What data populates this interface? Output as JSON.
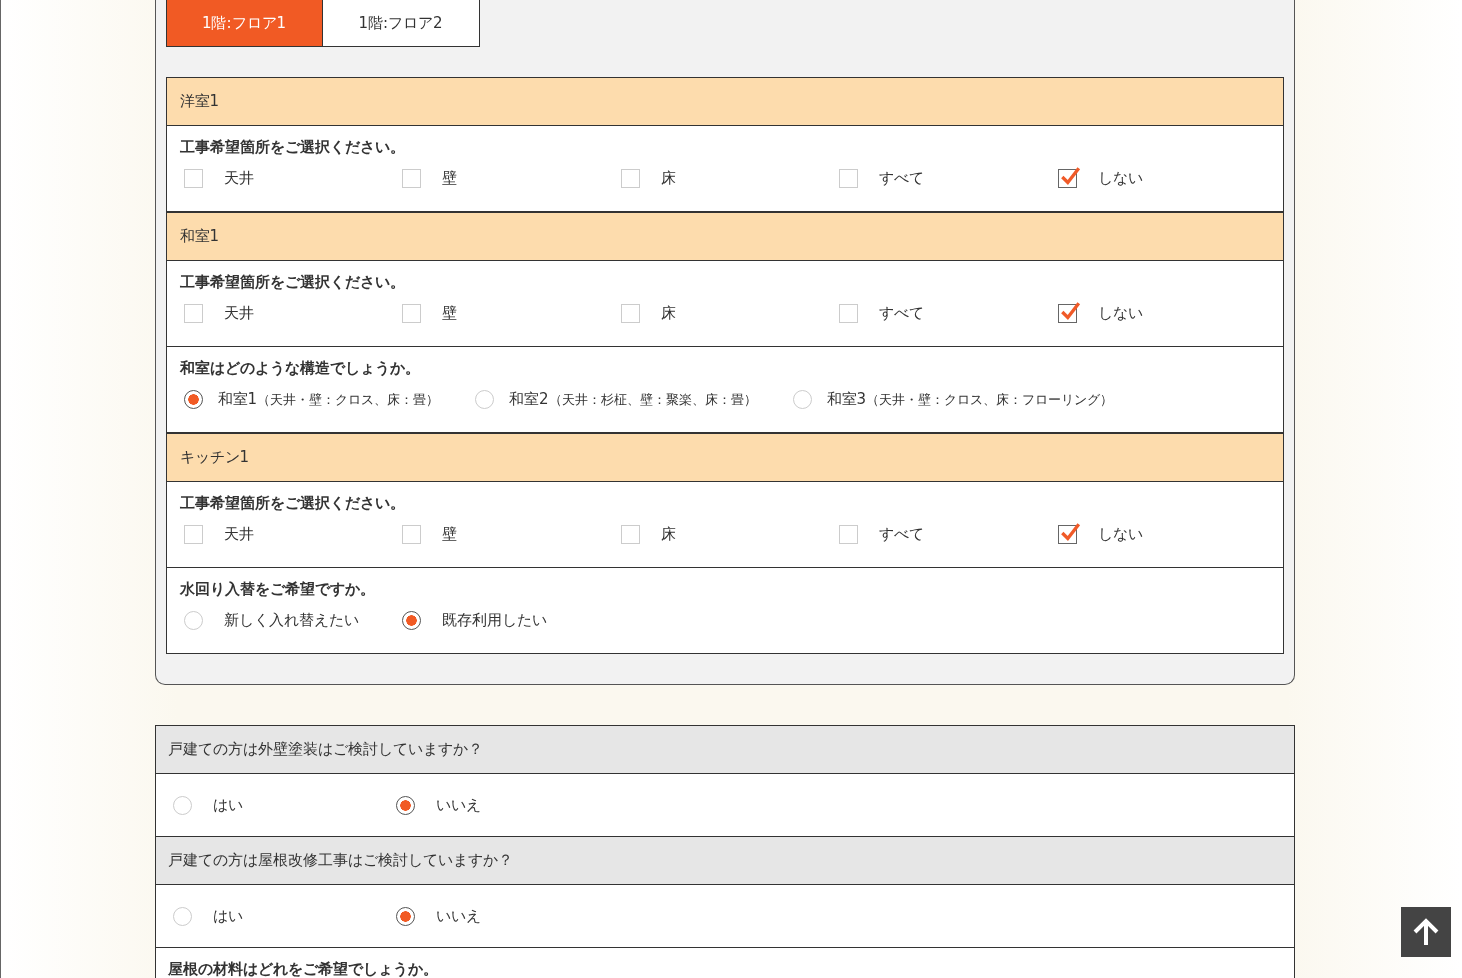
{
  "tabs": [
    {
      "label": "1階:フロア1",
      "selected": true
    },
    {
      "label": "1階:フロア2",
      "selected": false
    }
  ],
  "rooms": [
    {
      "name": "洋室1",
      "questions": [
        {
          "kind": "checkbox",
          "text": "工事希望箇所をご選択ください。",
          "options": [
            {
              "label": "天井",
              "checked": false
            },
            {
              "label": "壁",
              "checked": false
            },
            {
              "label": "床",
              "checked": false
            },
            {
              "label": "すべて",
              "checked": false
            },
            {
              "label": "しない",
              "checked": true
            }
          ]
        }
      ]
    },
    {
      "name": "和室1",
      "questions": [
        {
          "kind": "checkbox",
          "text": "工事希望箇所をご選択ください。",
          "options": [
            {
              "label": "天井",
              "checked": false
            },
            {
              "label": "壁",
              "checked": false
            },
            {
              "label": "床",
              "checked": false
            },
            {
              "label": "すべて",
              "checked": false
            },
            {
              "label": "しない",
              "checked": true
            }
          ]
        },
        {
          "kind": "flowradio",
          "text": "和室はどのような構造でしょうか。",
          "options": [
            {
              "label": "和室1",
              "detail": "（天井・壁：クロス、床：畳）",
              "selected": true
            },
            {
              "label": "和室2",
              "detail": "（天井：杉柾、壁：聚楽、床：畳）",
              "selected": false
            },
            {
              "label": "和室3",
              "detail": "（天井・壁：クロス、床：フローリング）",
              "selected": false
            }
          ]
        }
      ]
    },
    {
      "name": "キッチン1",
      "questions": [
        {
          "kind": "checkbox",
          "text": "工事希望箇所をご選択ください。",
          "options": [
            {
              "label": "天井",
              "checked": false
            },
            {
              "label": "壁",
              "checked": false
            },
            {
              "label": "床",
              "checked": false
            },
            {
              "label": "すべて",
              "checked": false
            },
            {
              "label": "しない",
              "checked": true
            }
          ]
        },
        {
          "kind": "radio",
          "text": "水回り入替をご希望ですか。",
          "options": [
            {
              "label": "新しく入れ替えたい",
              "selected": false
            },
            {
              "label": "既存利用したい",
              "selected": true
            }
          ]
        }
      ]
    }
  ],
  "questions": [
    {
      "kind": "gray",
      "title": "戸建ての方は外壁塗装はご検討していますか？",
      "options": [
        {
          "label": "はい",
          "selected": false
        },
        {
          "label": "いいえ",
          "selected": true
        }
      ]
    },
    {
      "kind": "gray",
      "title": "戸建ての方は屋根改修工事はご検討していますか？",
      "options": [
        {
          "label": "はい",
          "selected": false
        },
        {
          "label": "いいえ",
          "selected": true
        }
      ]
    },
    {
      "kind": "bold",
      "title": "屋根の材料はどれをご希望でしょうか。"
    }
  ]
}
